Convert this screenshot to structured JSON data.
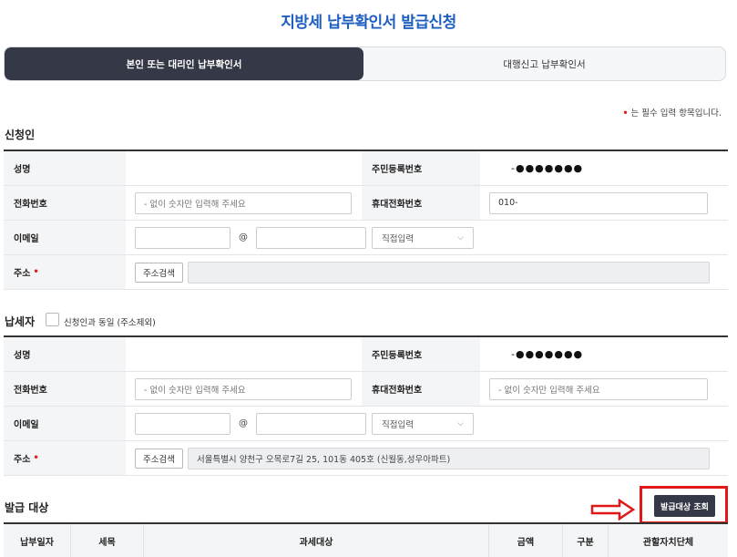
{
  "page_title": "지방세 납부확인서 발급신청",
  "tabs": [
    {
      "label": "본인 또는 대리인 납부확인서",
      "active": true
    },
    {
      "label": "대행신고 납부확인서",
      "active": false
    }
  ],
  "required_note": "는 필수 입력 항목입니다.",
  "required_mark": "•",
  "applicant": {
    "section_title": "신청인",
    "name_label": "성명",
    "name_value": "",
    "rrn_label": "주민등록번호",
    "rrn_value": "-●●●●●●●",
    "phone_label": "전화번호",
    "phone_placeholder": "- 없이 숫자만 입력해 주세요",
    "mobile_label": "휴대전화번호",
    "mobile_value": "010-",
    "email_label": "이메일",
    "email_at": "@",
    "email_domain_select": "직접입력",
    "address_label": "주소",
    "address_search_button": "주소검색",
    "address_value": ""
  },
  "taxpayer": {
    "section_title": "납세자",
    "same_as_applicant_label": "신청인과 동일 (주소제외)",
    "name_label": "성명",
    "name_value": "",
    "rrn_label": "주민등록번호",
    "rrn_value": "-●●●●●●●",
    "phone_label": "전화번호",
    "phone_placeholder": "- 없이 숫자만 입력해 주세요",
    "mobile_label": "휴대전화번호",
    "mobile_placeholder": "- 없이 숫자만 입력해 주세요",
    "email_label": "이메일",
    "email_at": "@",
    "email_domain_select": "직접입력",
    "address_label": "주소",
    "address_search_button": "주소검색",
    "address_value": "서울특별시 양천구 오목로7길 25, 101동 405호 (신월동,성우아파트)"
  },
  "issuance": {
    "section_title": "발급 대상",
    "query_button": "발급대상 조회",
    "columns": [
      "납부일자",
      "세목",
      "과세대상",
      "금액",
      "구분",
      "관할자치단체"
    ]
  },
  "colors": {
    "title_blue": "#1f5fbf",
    "dark_button": "#353846",
    "highlight_red": "#e01818"
  }
}
